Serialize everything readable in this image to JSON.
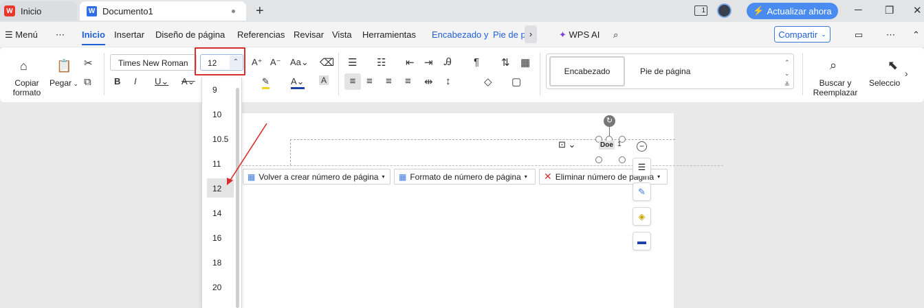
{
  "titlebar": {
    "home_tab": "Inicio",
    "doc_tab": "Documento1",
    "new_tab": "+",
    "update_button": "Actualizar ahora",
    "page_indicator": "1"
  },
  "menubar": {
    "menu": "Menú",
    "more": "⋯",
    "tabs": [
      "Inicio",
      "Insertar",
      "Diseño de página",
      "Referencias",
      "Revisar",
      "Vista",
      "Herramientas",
      "Encabezado y",
      "Pie de p"
    ],
    "wps_ai": "WPS AI",
    "share": "Compartir"
  },
  "ribbon": {
    "copy_format": "Copiar formato",
    "copy_format_l1": "Copiar",
    "copy_format_l2": "formato",
    "paste": "Pegar",
    "font_name": "Times New Roman",
    "font_size": "12",
    "style_header": "Encabezado",
    "style_footer": "Pie de página",
    "find_l1": "Buscar y",
    "find_l2": "Reemplazar",
    "select": "Seleccio"
  },
  "font_size_options": [
    "9",
    "10",
    "10.5",
    "11",
    "12",
    "14",
    "16",
    "18",
    "20"
  ],
  "selected_size": "12",
  "header_toolbar": {
    "recreate": "Volver a crear número de página",
    "format": "Formato de número de página",
    "delete": "Eliminar número de página"
  },
  "page_number_text": "Doe",
  "page_number_digit": "1",
  "colors": {
    "accent": "#1f5fd6",
    "highlight_box": "#d72f2f",
    "update_button": "#4a8bf2"
  }
}
